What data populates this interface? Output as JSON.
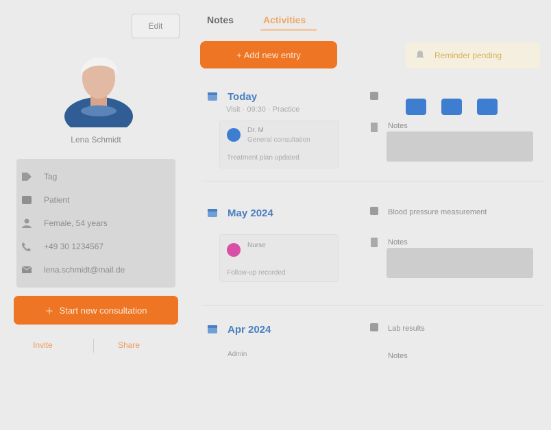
{
  "profile": {
    "edit_label": "Edit",
    "name": "Lena Schmidt",
    "info": [
      {
        "icon": "tag-icon",
        "text": "Tag"
      },
      {
        "icon": "id-card-icon",
        "text": "Patient"
      },
      {
        "icon": "person-icon",
        "text": "Female, 54 years"
      },
      {
        "icon": "phone-icon",
        "text": "+49 30 1234567"
      },
      {
        "icon": "mail-icon",
        "text": "lena.schmidt@mail.de"
      }
    ],
    "cta_label": "Start new consultation",
    "link_left": "Invite",
    "link_right": "Share"
  },
  "tabs": [
    {
      "label": "Notes",
      "active": false
    },
    {
      "label": "Activities",
      "active": true
    }
  ],
  "main": {
    "new_button_label": "+ Add new entry",
    "notice_text": "Reminder pending"
  },
  "entries": [
    {
      "title": "Today",
      "subtitle": "Visit · 09:30 · Practice",
      "badge": "Dr. M",
      "mini_label": "General consultation",
      "mini_footer": "Treatment plan updated",
      "right_heading": "",
      "right_note": "Notes"
    },
    {
      "title": "May 2024",
      "subtitle": "",
      "badge": "Nurse",
      "mini_label": "",
      "mini_footer": "Follow-up recorded",
      "right_heading": "Blood pressure measurement",
      "right_note": "Notes"
    },
    {
      "title": "Apr 2024",
      "subtitle": "",
      "badge": "Admin",
      "mini_label": "",
      "mini_footer": "",
      "right_heading": "Lab results",
      "right_note": "Notes"
    }
  ],
  "colors": {
    "accent": "#ee7524",
    "link": "#4a7fc0",
    "chip": "#3d7ed0",
    "notice_bg": "#f5efe0",
    "badge_pink": "#d94fa8"
  }
}
